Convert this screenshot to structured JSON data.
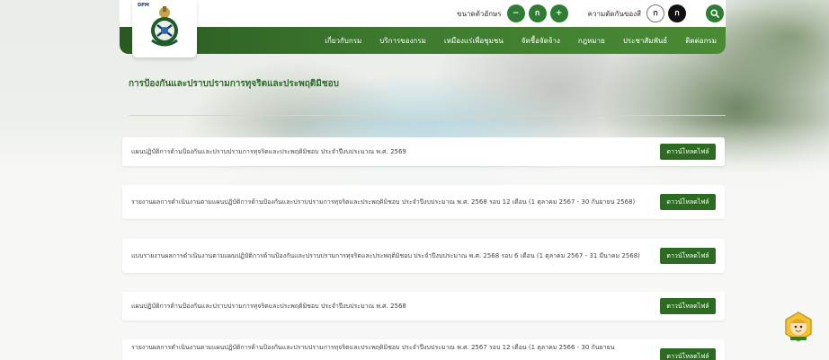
{
  "header": {
    "logo_text": "DPM",
    "font_size_label": "ขนาดตัวอักษร",
    "font_decrease": "−",
    "font_normal": "ก",
    "font_increase": "+",
    "contrast_label": "ความตัดกันของสี",
    "contrast_normal": "ก",
    "contrast_dark": "ก"
  },
  "nav": {
    "items": [
      "เกี่ยวกับกรม",
      "บริการของกรม",
      "เหมืองแร่เพื่อชุมชน",
      "จัดซื้อจัดจ้าง",
      "กฎหมาย",
      "ประชาสัมพันธ์",
      "ติดต่อกรม"
    ]
  },
  "page": {
    "title": "การป้องกันและปราบปรามการทุจริตและประพฤติมิชอบ"
  },
  "download_label": "ดาวน์โหลดไฟล์",
  "documents": [
    {
      "text": "แผนปฏิบัติการด้านป้องกันและปราบปรามการทุจริตและประพฤติมิชอบ ประจำปีงบประมาณ พ.ศ. 2569"
    },
    {
      "text": "รายงานผลการดำเนินงานตามแผนปฏิบัติการด้านป้องกันและปราบปรามการทุจริตและประพฤติมิชอบ ประจำปีงบประมาณ พ.ศ. 2568 รอบ 12 เดือน (1 ตุลาคม 2567 - 30 กันยายน 2568)"
    },
    {
      "text": "แบบรายงานผลการดำเนินงานตามแผนปฏิบัติการด้านป้องกันและปราบปรามการทุจริตและประพฤติมิชอบ ประจำปีงบประมาณ พ.ศ. 2568 รอบ 6 เดือน (1 ตุลาคม 2567 - 31 มีนาคม 2568)"
    },
    {
      "text": "แผนปฏิบัติการด้านป้องกันและปราบปรามการทุจริตและประพฤติมิชอบ ประจำปีงบประมาณ พ.ศ. 2568"
    },
    {
      "text": "รายงานผลการดำเนินงานตามแผนปฏิบัติการด้านป้องกันและปราบปรามการทุจริตและประพฤติมิชอบ ประจำปีงบประมาณ พ.ศ. 2567 รอบ 12 เดือน (1 ตุลาคม 2566 - 30 กันยายน"
    }
  ],
  "colors": {
    "brand_green": "#2e6b22",
    "title_green": "#2f6a2a",
    "nav_green": "#3d7a2e"
  }
}
